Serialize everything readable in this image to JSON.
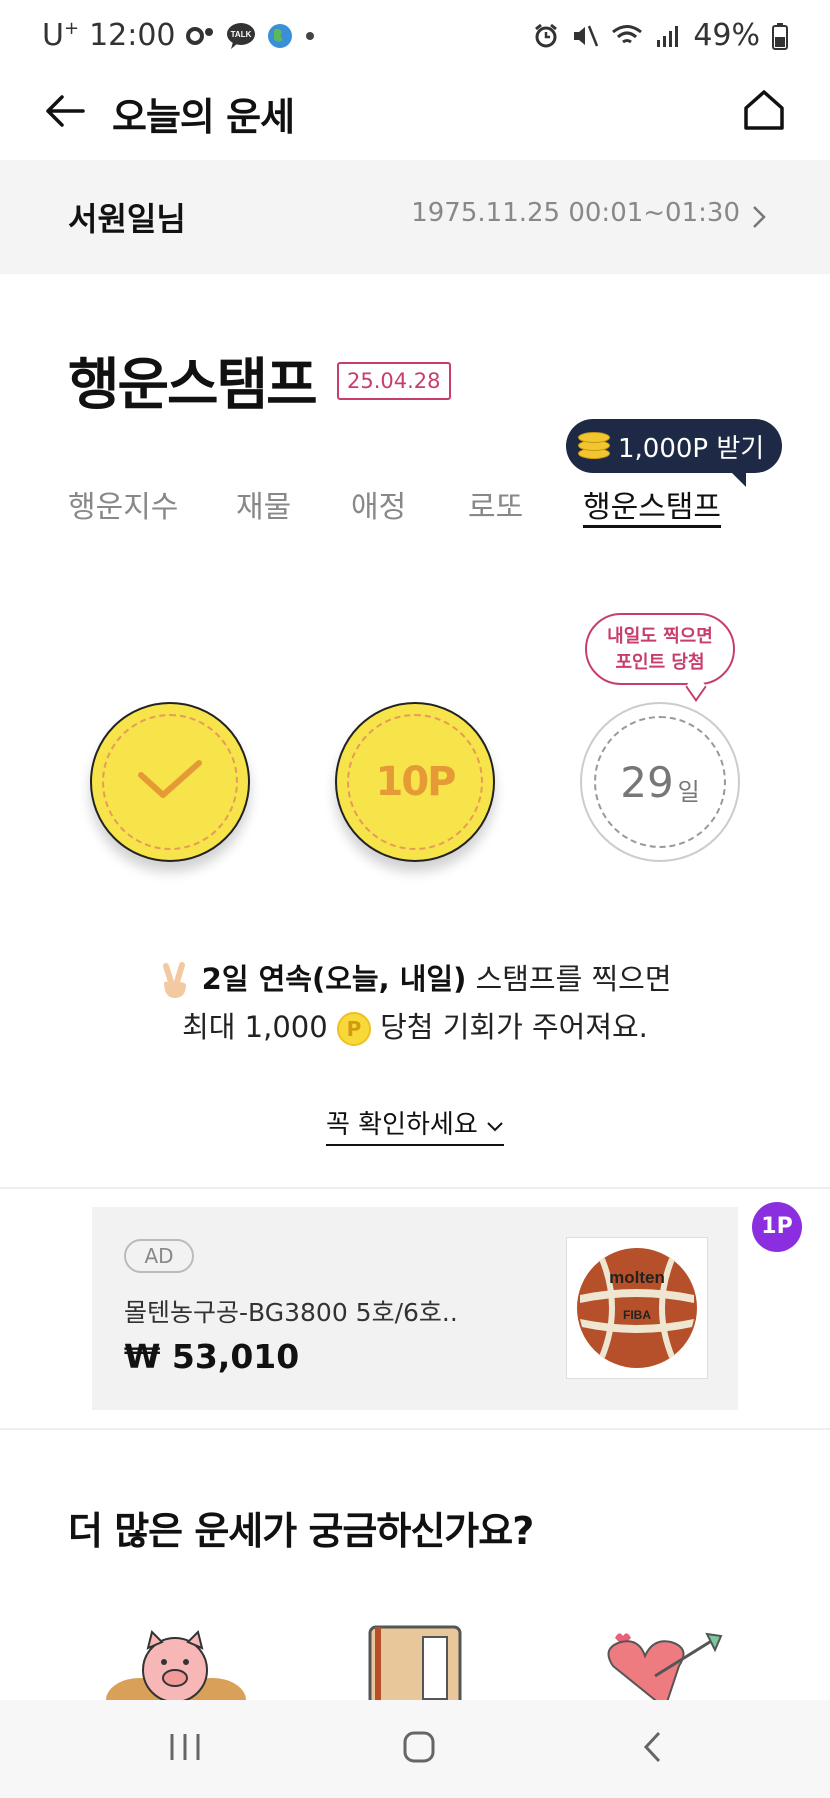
{
  "status_bar": {
    "carrier": "U",
    "carrier_sup": "+",
    "time": "12:00",
    "battery": "49%",
    "icons": [
      "talk-icon",
      "kakao-talk-icon",
      "globe-icon",
      "dot-icon",
      "alarm-icon",
      "mute-icon",
      "wifi-icon",
      "signal-icon",
      "battery-icon"
    ]
  },
  "header": {
    "title": "오늘의 운세"
  },
  "profile": {
    "name": "서원일님",
    "birth": "1975.11.25 00:01~01:30"
  },
  "section": {
    "title": "행운스탬프",
    "date": "25.04.28"
  },
  "tabs": [
    {
      "label": "행운지수"
    },
    {
      "label": "재물"
    },
    {
      "label": "애정"
    },
    {
      "label": "로또"
    },
    {
      "label": "행운스탬프",
      "active": true
    }
  ],
  "points_bubble": {
    "label": "1,000P 받기"
  },
  "stamps": {
    "second_label": "10P",
    "third_day": "29",
    "third_unit": "일"
  },
  "tomorrow_bubble": {
    "line1": "내일도 찍으면",
    "line2": "포인트 당첨"
  },
  "info": {
    "bold": "2일 연속(오늘, 내일)",
    "rest1": " 스탬프를 찍으면",
    "line2_prefix": "최대 1,000 ",
    "coin": "P",
    "line2_suffix": " 당첨 기회가 주어져요."
  },
  "check_link": "꼭 확인하세요",
  "ad": {
    "badge": "AD",
    "title": "몰텐농구공-BG3800 5호/6호..",
    "price": "₩ 53,010",
    "point_badge": "1P",
    "ball_brand": "molten",
    "ball_text": "FIBA"
  },
  "more": {
    "title": "더 많은 운세가 궁금하신가요?"
  },
  "colors": {
    "accent_pink": "#c83e6a",
    "stamp_yellow": "#f7e44a",
    "bubble_navy": "#1e2a45",
    "badge_purple": "#8b2ee0"
  }
}
